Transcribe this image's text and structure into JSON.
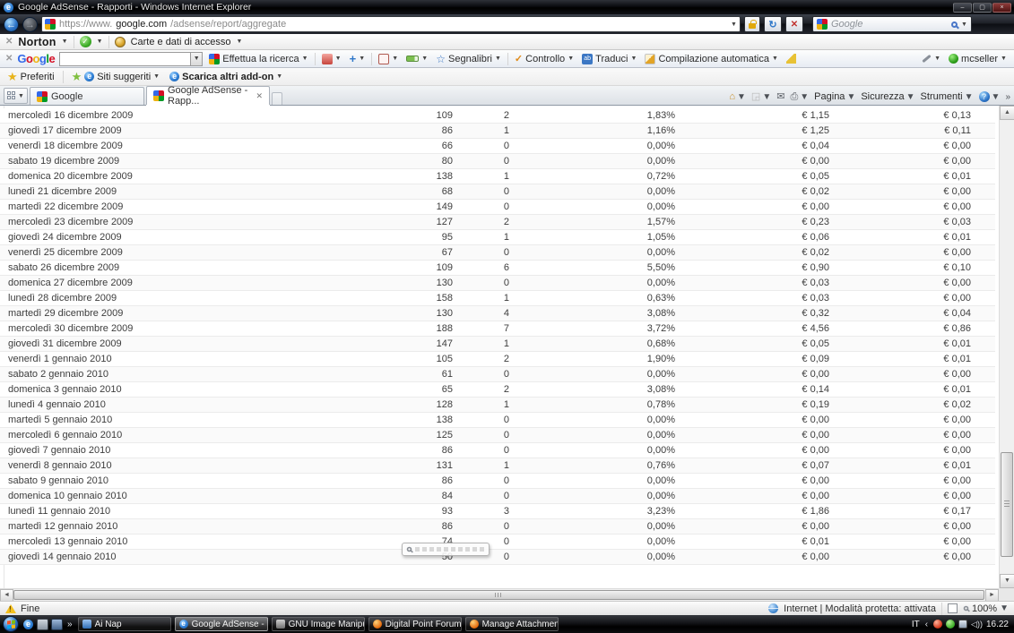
{
  "brand": {
    "logo_colors": [
      "#3369e8",
      "#d50f25",
      "#eeb211",
      "#3369e8",
      "#009925",
      "#d50f25"
    ]
  },
  "titlebar": {
    "title": "Google AdSense - Rapporti - Windows Internet Explorer"
  },
  "nav": {
    "url_pre": "https://www.",
    "url_domain": "google.com",
    "url_path": "/adsense/report/aggregate",
    "search_text": "Google"
  },
  "norton_bar": {
    "brand": "Norton",
    "cards_label": "Carte e dati di accesso"
  },
  "google_bar": {
    "logo": "Google",
    "search_button": "Effettua la ricerca",
    "bookmarks": "Segnalibri",
    "monitor": "Controllo",
    "translate": "Traduci",
    "autofill": "Compilazione automatica",
    "account": "mcseller"
  },
  "favorites_bar": {
    "favorites": "Preferiti",
    "suggested_sites": "Siti suggeriti",
    "get_addons": "Scarica altri add-on"
  },
  "tab_bar": {
    "tabs": [
      {
        "label": "Google"
      },
      {
        "label": "Google AdSense - Rapp..."
      }
    ],
    "page": "Pagina",
    "security": "Sicurezza",
    "tools": "Strumenti"
  },
  "table": {
    "rows": [
      [
        "mercoledì 16 dicembre 2009",
        "109",
        "2",
        "1,83%",
        "€ 1,15",
        "€ 0,13"
      ],
      [
        "giovedì 17 dicembre 2009",
        "86",
        "1",
        "1,16%",
        "€ 1,25",
        "€ 0,11"
      ],
      [
        "venerdì 18 dicembre 2009",
        "66",
        "0",
        "0,00%",
        "€ 0,04",
        "€ 0,00"
      ],
      [
        "sabato 19 dicembre 2009",
        "80",
        "0",
        "0,00%",
        "€ 0,00",
        "€ 0,00"
      ],
      [
        "domenica 20 dicembre 2009",
        "138",
        "1",
        "0,72%",
        "€ 0,05",
        "€ 0,01"
      ],
      [
        "lunedì 21 dicembre 2009",
        "68",
        "0",
        "0,00%",
        "€ 0,02",
        "€ 0,00"
      ],
      [
        "martedì 22 dicembre 2009",
        "149",
        "0",
        "0,00%",
        "€ 0,00",
        "€ 0,00"
      ],
      [
        "mercoledì 23 dicembre 2009",
        "127",
        "2",
        "1,57%",
        "€ 0,23",
        "€ 0,03"
      ],
      [
        "giovedì 24 dicembre 2009",
        "95",
        "1",
        "1,05%",
        "€ 0,06",
        "€ 0,01"
      ],
      [
        "venerdì 25 dicembre 2009",
        "67",
        "0",
        "0,00%",
        "€ 0,02",
        "€ 0,00"
      ],
      [
        "sabato 26 dicembre 2009",
        "109",
        "6",
        "5,50%",
        "€ 0,90",
        "€ 0,10"
      ],
      [
        "domenica 27 dicembre 2009",
        "130",
        "0",
        "0,00%",
        "€ 0,03",
        "€ 0,00"
      ],
      [
        "lunedì 28 dicembre 2009",
        "158",
        "1",
        "0,63%",
        "€ 0,03",
        "€ 0,00"
      ],
      [
        "martedì 29 dicembre 2009",
        "130",
        "4",
        "3,08%",
        "€ 0,32",
        "€ 0,04"
      ],
      [
        "mercoledì 30 dicembre 2009",
        "188",
        "7",
        "3,72%",
        "€ 4,56",
        "€ 0,86"
      ],
      [
        "giovedì 31 dicembre 2009",
        "147",
        "1",
        "0,68%",
        "€ 0,05",
        "€ 0,01"
      ],
      [
        "venerdì 1 gennaio 2010",
        "105",
        "2",
        "1,90%",
        "€ 0,09",
        "€ 0,01"
      ],
      [
        "sabato 2 gennaio 2010",
        "61",
        "0",
        "0,00%",
        "€ 0,00",
        "€ 0,00"
      ],
      [
        "domenica 3 gennaio 2010",
        "65",
        "2",
        "3,08%",
        "€ 0,14",
        "€ 0,01"
      ],
      [
        "lunedì 4 gennaio 2010",
        "128",
        "1",
        "0,78%",
        "€ 0,19",
        "€ 0,02"
      ],
      [
        "martedì 5 gennaio 2010",
        "138",
        "0",
        "0,00%",
        "€ 0,00",
        "€ 0,00"
      ],
      [
        "mercoledì 6 gennaio 2010",
        "125",
        "0",
        "0,00%",
        "€ 0,00",
        "€ 0,00"
      ],
      [
        "giovedì 7 gennaio 2010",
        "86",
        "0",
        "0,00%",
        "€ 0,00",
        "€ 0,00"
      ],
      [
        "venerdì 8 gennaio 2010",
        "131",
        "1",
        "0,76%",
        "€ 0,07",
        "€ 0,01"
      ],
      [
        "sabato 9 gennaio 2010",
        "86",
        "0",
        "0,00%",
        "€ 0,00",
        "€ 0,00"
      ],
      [
        "domenica 10 gennaio 2010",
        "84",
        "0",
        "0,00%",
        "€ 0,00",
        "€ 0,00"
      ],
      [
        "lunedì 11 gennaio 2010",
        "93",
        "3",
        "3,23%",
        "€ 1,86",
        "€ 0,17"
      ],
      [
        "martedì 12 gennaio 2010",
        "86",
        "0",
        "0,00%",
        "€ 0,00",
        "€ 0,00"
      ],
      [
        "mercoledì 13 gennaio 2010",
        "74",
        "0",
        "0,00%",
        "€ 0,01",
        "€ 0,00"
      ],
      [
        "giovedì 14 gennaio 2010",
        "50",
        "0",
        "0,00%",
        "€ 0,00",
        "€ 0,00"
      ]
    ]
  },
  "status_bar": {
    "done": "Fine",
    "zone": "Internet | Modalità protetta: attivata",
    "zoom": "100%"
  },
  "taskbar": {
    "buttons": [
      "Ai Nap",
      "Google AdSense - R...",
      "GNU Image Manipu...",
      "Digital Point Forum...",
      "Manage Attachmen..."
    ],
    "lang": "IT",
    "clock": "16.22"
  }
}
